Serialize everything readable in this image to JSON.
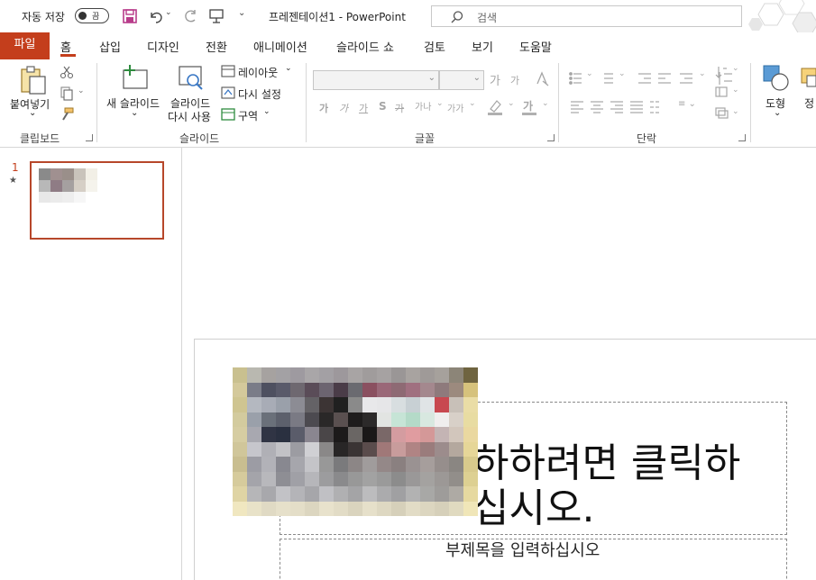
{
  "titlebar": {
    "autosave_label": "자동 저장",
    "autosave_state": "끔",
    "doc_title": "프레젠테이션1  -  PowerPoint",
    "search_placeholder": "검색"
  },
  "tabs": {
    "file": "파일",
    "items": [
      "홈",
      "삽입",
      "디자인",
      "전환",
      "애니메이션",
      "슬라이드 쇼",
      "검토",
      "보기",
      "도움말"
    ],
    "active": "홈"
  },
  "ribbon": {
    "clipboard": {
      "paste": "붙여넣기",
      "label": "클립보드"
    },
    "slides": {
      "new_slide": "새 슬라이드",
      "reuse_1": "슬라이드",
      "reuse_2": "다시 사용",
      "layout": "레이아웃",
      "reset": "다시 설정",
      "section": "구역",
      "label": "슬라이드"
    },
    "font": {
      "label": "글꼴",
      "grow": "가",
      "shrink": "가",
      "b": "가",
      "i": "가",
      "u": "가",
      "s": "S",
      "strike": "가",
      "spacing": "가나",
      "case": "가가",
      "highlight": "가"
    },
    "paragraph": {
      "label": "단락"
    },
    "drawing": {
      "shapes": "도형",
      "arrange": "정"
    }
  },
  "thumbnails": {
    "slide_number": "1",
    "star": "★"
  },
  "slide": {
    "title_line1": "하하려면 클릭하",
    "title_line2": "십시오.",
    "subtitle": "부제목을 입력하십시오"
  },
  "colors": {
    "accent": "#c43e1c",
    "thumb_border": "#b7472a"
  }
}
